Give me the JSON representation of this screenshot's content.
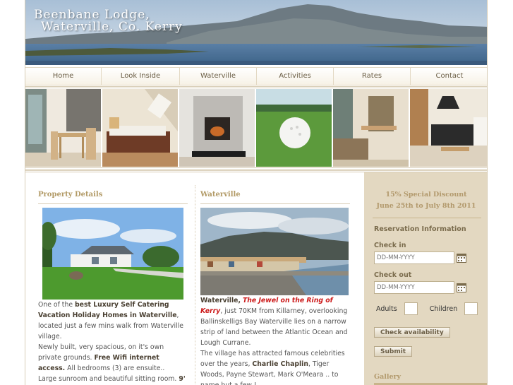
{
  "header": {
    "title_line1": "Beenbane Lodge,",
    "title_line2": "Waterville, Co. Kerry"
  },
  "nav": {
    "items": [
      {
        "label": "Home"
      },
      {
        "label": "Look Inside"
      },
      {
        "label": "Waterville"
      },
      {
        "label": "Activities"
      },
      {
        "label": "Rates"
      },
      {
        "label": "Contact"
      }
    ]
  },
  "property": {
    "title": "Property Details",
    "p1_pre": "One of the ",
    "p1_bold": "best Luxury Self Catering Vacation Holiday Homes in Waterville",
    "p1_post": ", located just a few mins walk from Waterville village.",
    "p2_pre": "Newly built, very spacious, on it's own private grounds. ",
    "p2_bold": "Free Wifi internet access.",
    "p2_post": " All bedrooms (3) are ensuite..",
    "p3_pre": "Large sunroom and beautiful sitting room. ",
    "p3_bold": "9'"
  },
  "waterville": {
    "title": "Waterville",
    "lead_bold": "Waterville,",
    "lead_link": "The Jewel on the Ring of Kerry",
    "lead_post": ", just 70KM from Killarney, overlooking Ballinskelligs Bay Waterville lies on a narrow strip of land between the Atlantic Ocean and Lough Currane.",
    "p2_pre": "The village has attracted famous celebrities over the years, ",
    "p2_bold": "Charlie Chaplin",
    "p2_post": ", Tiger Woods, Payne Stewart, Mark O'Meara .. to name but a few !"
  },
  "sidebar": {
    "discount_line1": "15% Special Discount",
    "discount_line2": "June 25th to July 8th 2011",
    "reservation_title": "Reservation Information",
    "checkin_label": "Check in",
    "checkin_placeholder": "DD-MM-YYYY",
    "checkout_label": "Check out",
    "checkout_placeholder": "DD-MM-YYYY",
    "adults_label": "Adults",
    "children_label": "Children",
    "check_button": "Check availability",
    "submit_button": "Submit",
    "gallery_title": "Gallery"
  },
  "colors": {
    "accent_gold": "#b29a66",
    "sidebar_bg": "#e3d8c1",
    "link_red": "#cc1a1a"
  }
}
